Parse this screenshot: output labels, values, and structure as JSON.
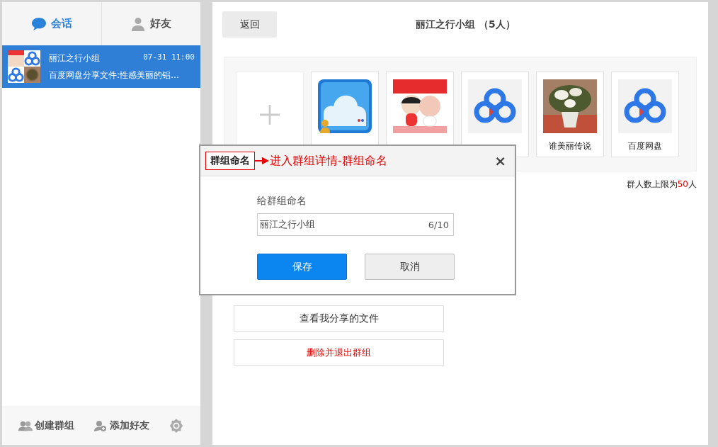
{
  "tabs": [
    {
      "label": "会话",
      "selected": true,
      "kind": "chat"
    },
    {
      "label": "好友",
      "selected": false,
      "kind": "person"
    }
  ],
  "conversations": [
    {
      "name": "丽江之行小组",
      "time": "07-31  11:00",
      "preview": "百度网盘分享文件:性感美丽的铝…",
      "selected": true
    }
  ],
  "footer": [
    {
      "label": "创建群组",
      "kind": "group"
    },
    {
      "label": "添加好友",
      "kind": "add-person"
    },
    {
      "kind": "settings"
    }
  ],
  "header": {
    "back": "返回",
    "title": "丽江之行小组 （5人）"
  },
  "members": [
    {
      "kind": "app"
    },
    {
      "kind": "cartoon"
    },
    {
      "kind": "logo"
    },
    {
      "name": "谁美丽传说"
    },
    {
      "kind": "logo",
      "name": "百度网盘"
    }
  ],
  "limit": {
    "prefix": "群人数上限为",
    "count": "50",
    "suffix": "人"
  },
  "actions": [
    {
      "label": "查看我分享的文件",
      "danger": false
    },
    {
      "label": "删除并退出群组",
      "danger": true
    }
  ],
  "dialog": {
    "title": "群组命名",
    "annotation": "进入群组详情-群组命名",
    "close": "×",
    "label": "给群组命名",
    "value": "丽江之行小组",
    "counter": "6/10",
    "buttons": [
      {
        "label": "保存",
        "primary": true
      },
      {
        "label": "取消",
        "primary": false
      }
    ]
  }
}
